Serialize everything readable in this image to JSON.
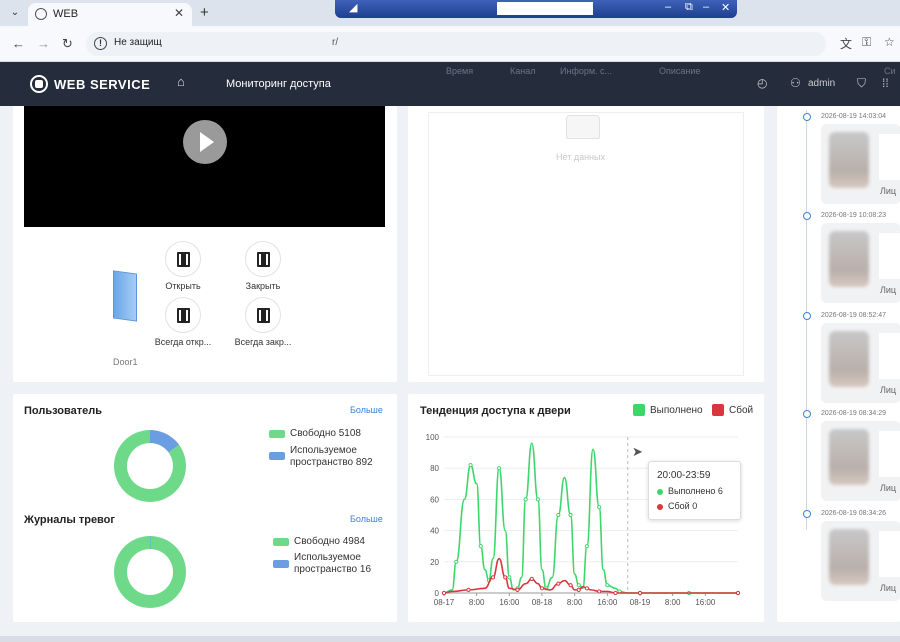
{
  "browser": {
    "tab_title": "WEB",
    "tab_close": "✕",
    "new_tab": "+",
    "menu_glyph": "⌄",
    "url_warning": "Не защищ",
    "url_suffix": "r/",
    "nav": {
      "back": "←",
      "forward": "→",
      "reload": "↻"
    },
    "right_icons": [
      "translate-icon",
      "key-icon",
      "star-icon"
    ],
    "overlay_controls": [
      "–",
      "⧉",
      "–",
      "▫",
      "✕"
    ]
  },
  "header": {
    "logo": "WEB SERVICE",
    "title": "Мониторинг доступа",
    "user": "admin",
    "ghost_columns": [
      "Время",
      "Канал",
      "Информ. с...",
      "Описание"
    ],
    "ghost_right": "Си"
  },
  "door": {
    "name": "Door1",
    "actions": [
      {
        "label": "Открыть",
        "icon": "door-open-icon"
      },
      {
        "label": "Закрыть",
        "icon": "door-close-icon"
      },
      {
        "label": "Всегда откр...",
        "icon": "door-always-open-icon"
      },
      {
        "label": "Всегда закр...",
        "icon": "door-always-closed-icon"
      }
    ]
  },
  "events": {
    "empty_text": "Нет данных"
  },
  "users": {
    "title": "Пользователь",
    "more": "Больше",
    "free_label": "Свободно 5108",
    "used_label": "Используемое пространство 892",
    "free": 5108,
    "used": 892
  },
  "alarms": {
    "title": "Журналы тревог",
    "more": "Больше",
    "free_label": "Свободно 4984",
    "used_label": "Используемое пространство 16",
    "free": 4984,
    "used": 16
  },
  "trend": {
    "title": "Тенденция доступа к двери",
    "legend_success": "Выполнено",
    "legend_fail": "Сбой",
    "color_success": "#3ed66b",
    "color_fail": "#d9363e",
    "tooltip": {
      "title": "20:00-23:59",
      "success": "Выполнено 6",
      "fail": "Сбой 0"
    }
  },
  "chart_data": {
    "type": "line",
    "title": "Тенденция доступа к двери",
    "ylim": [
      0,
      100
    ],
    "yticks": [
      0,
      20,
      40,
      60,
      80,
      100
    ],
    "xticks": [
      "08-17",
      "8:00",
      "16:00",
      "08-18",
      "8:00",
      "16:00",
      "08-19",
      "8:00",
      "16:00"
    ],
    "x_hours": [
      0,
      8,
      16,
      24,
      32,
      40,
      48,
      56,
      64
    ],
    "xlim_hours": [
      0,
      72
    ],
    "legend": "top-right",
    "series": [
      {
        "name": "Выполнено",
        "color": "#3ed66b",
        "points": [
          [
            0,
            0
          ],
          [
            2,
            2
          ],
          [
            3,
            20
          ],
          [
            5,
            60
          ],
          [
            6.5,
            82
          ],
          [
            8,
            70
          ],
          [
            9,
            30
          ],
          [
            10,
            15
          ],
          [
            11,
            8
          ],
          [
            12,
            22
          ],
          [
            13.5,
            80
          ],
          [
            15,
            40
          ],
          [
            16,
            10
          ],
          [
            17,
            2
          ],
          [
            18,
            3
          ],
          [
            19,
            10
          ],
          [
            20,
            60
          ],
          [
            21.5,
            96
          ],
          [
            23,
            60
          ],
          [
            24,
            15
          ],
          [
            25,
            3
          ],
          [
            26.5,
            10
          ],
          [
            28,
            50
          ],
          [
            29.5,
            74
          ],
          [
            31,
            50
          ],
          [
            32,
            12
          ],
          [
            33,
            5
          ],
          [
            34,
            3
          ],
          [
            35,
            30
          ],
          [
            36.5,
            92
          ],
          [
            38,
            55
          ],
          [
            39,
            15
          ],
          [
            40,
            5
          ],
          [
            42,
            3
          ],
          [
            43,
            1
          ],
          [
            45,
            0
          ],
          [
            48,
            0
          ],
          [
            55,
            0
          ],
          [
            60,
            0
          ],
          [
            66,
            0
          ],
          [
            72,
            0
          ]
        ]
      },
      {
        "name": "Сбой",
        "color": "#d9363e",
        "points": [
          [
            0,
            0
          ],
          [
            2,
            1
          ],
          [
            6,
            2
          ],
          [
            10,
            3
          ],
          [
            12,
            10
          ],
          [
            13.5,
            22
          ],
          [
            15,
            10
          ],
          [
            16,
            3
          ],
          [
            18,
            2
          ],
          [
            20,
            6
          ],
          [
            21.5,
            9
          ],
          [
            23,
            6
          ],
          [
            24,
            3
          ],
          [
            26,
            2
          ],
          [
            28,
            6
          ],
          [
            29.5,
            8
          ],
          [
            31,
            5
          ],
          [
            32,
            2
          ],
          [
            33,
            2
          ],
          [
            34,
            4
          ],
          [
            35,
            3
          ],
          [
            36,
            2
          ],
          [
            38,
            1
          ],
          [
            40,
            1
          ],
          [
            42,
            0
          ],
          [
            45,
            0
          ],
          [
            48,
            0
          ],
          [
            60,
            0
          ],
          [
            72,
            0
          ]
        ]
      }
    ]
  },
  "timeline": [
    {
      "time": "2026-08-19 14:03:04",
      "label": "Лиц"
    },
    {
      "time": "2026-08-19 10:08:23",
      "label": "Лиц"
    },
    {
      "time": "2026-08-19 08:52:47",
      "label": "Лиц"
    },
    {
      "time": "2026-08-19 08:34:29",
      "label": "Лиц"
    },
    {
      "time": "2026-08-19 08:34:26",
      "label": "Лиц"
    }
  ]
}
